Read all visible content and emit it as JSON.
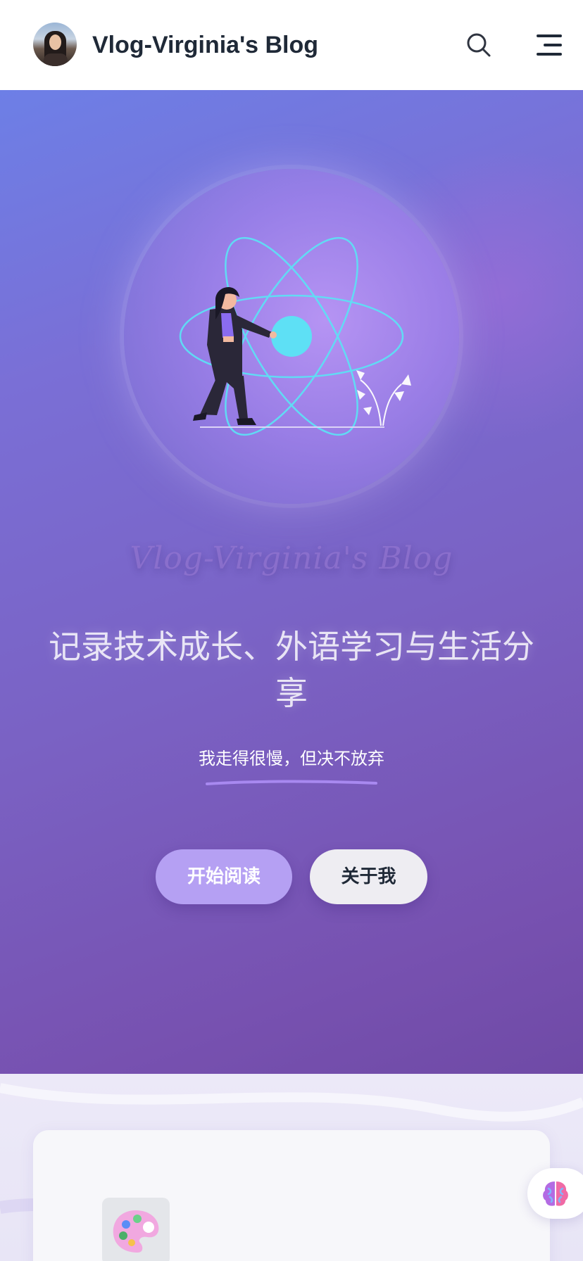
{
  "header": {
    "title": "Vlog-Virginia's Blog",
    "avatar_icon": "avatar-photo",
    "search_icon": "search-icon",
    "menu_icon": "menu-icon"
  },
  "hero": {
    "script_title": "Vlog-Virginia's Blog",
    "headline": "记录技术成长、外语学习与生活分享",
    "subline": "我走得很慢，但决不放弃",
    "primary_button": "开始阅读",
    "secondary_button": "关于我",
    "illustration_icon": "react-atom-woman-illustration"
  },
  "content": {
    "card_icon": "palette-icon",
    "floating_button_icon": "brain-icon"
  },
  "colors": {
    "hero_start": "#6d7fe6",
    "hero_end": "#6f4aa6",
    "primary_button": "#b5a0f3",
    "atom_cyan": "#5ee0f5"
  }
}
